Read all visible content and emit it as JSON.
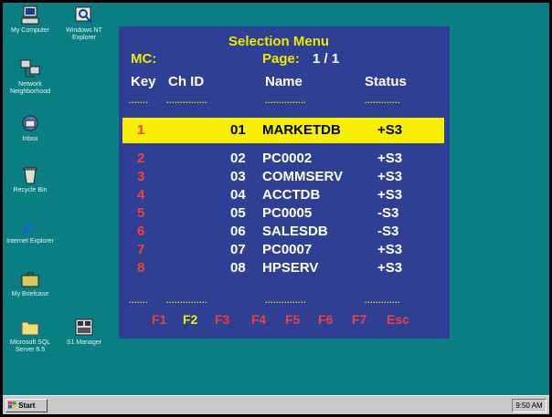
{
  "desktop": {
    "icons": [
      {
        "label": "My Computer",
        "icon": "computer-icon"
      },
      {
        "label": "Windows NT Explorer",
        "icon": "explorer-icon"
      },
      {
        "label": "Network Neighborhood",
        "icon": "network-icon"
      },
      {
        "label": "Inbox",
        "icon": "inbox-icon"
      },
      {
        "label": "Recycle Bin",
        "icon": "recycle-bin-icon"
      },
      {
        "label": "Internet Explorer",
        "icon": "internet-explorer-icon"
      },
      {
        "label": "My Briefcase",
        "icon": "briefcase-icon"
      },
      {
        "label": "Microsoft SQL Server 6.5",
        "icon": "folder-icon"
      },
      {
        "label": "S1 Manager",
        "icon": "manager-icon"
      }
    ]
  },
  "menu": {
    "title": "Selection Menu",
    "mc_label": "MC:",
    "page_label": "Page:",
    "page_value": "1 / 1",
    "headers": {
      "key": "Key",
      "chid": "Ch ID",
      "name": "Name",
      "status": "Status"
    },
    "rows": [
      {
        "key": "1",
        "chid": "01",
        "name": "MARKETDB",
        "status": "+S3",
        "selected": true
      },
      {
        "key": "2",
        "chid": "02",
        "name": "PC0002",
        "status": "+S3"
      },
      {
        "key": "3",
        "chid": "03",
        "name": "COMMSERV",
        "status": "+S3"
      },
      {
        "key": "4",
        "chid": "04",
        "name": "ACCTDB",
        "status": "+S3"
      },
      {
        "key": "5",
        "chid": "05",
        "name": "PC0005",
        "status": "-S3"
      },
      {
        "key": "6",
        "chid": "06",
        "name": "SALESDB",
        "status": "-S3"
      },
      {
        "key": "7",
        "chid": "07",
        "name": "PC0007",
        "status": "+S3"
      },
      {
        "key": "8",
        "chid": "08",
        "name": "HPSERV",
        "status": "+S3"
      }
    ],
    "function_keys": [
      "F1",
      "F2",
      "F3",
      "F4",
      "F5",
      "F6",
      "F7",
      "Esc"
    ],
    "colors": {
      "panel": "#2f3f93",
      "accent": "#f2e600",
      "key_red": "#f0403a",
      "highlight": "#f7ee00"
    }
  },
  "taskbar": {
    "start_label": "Start",
    "clock": "9:50 AM"
  }
}
